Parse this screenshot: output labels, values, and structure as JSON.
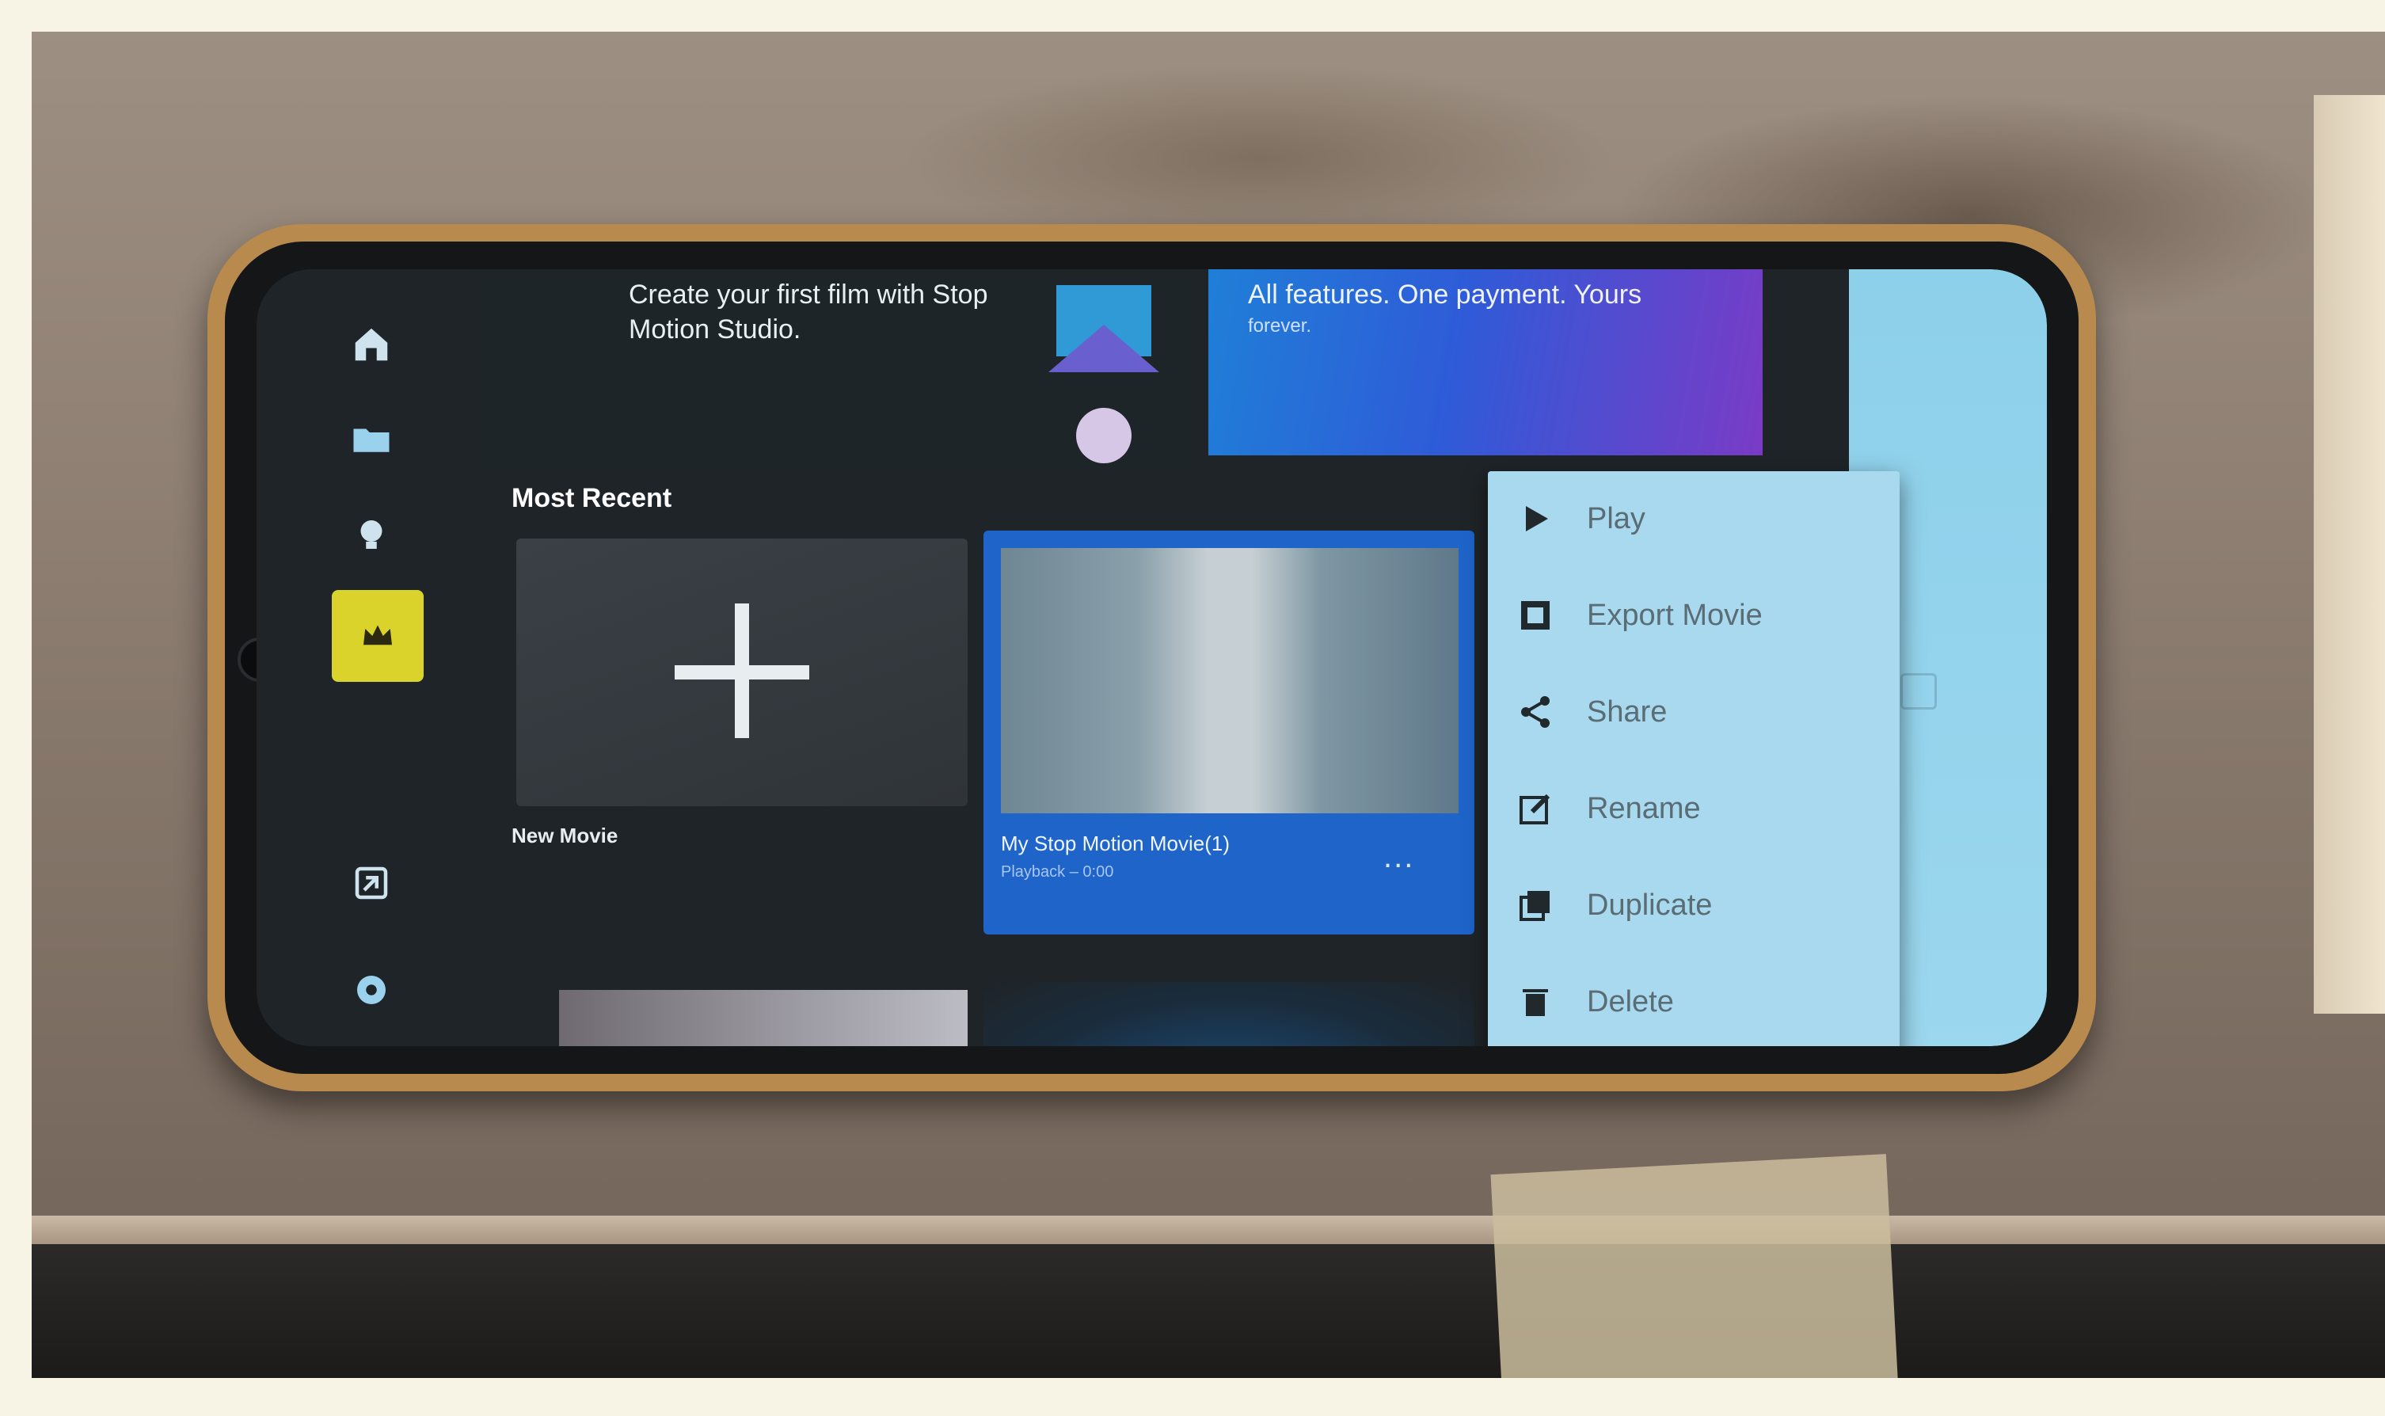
{
  "banner_promo": {
    "text": "Create your first film with Stop Motion Studio."
  },
  "banner_pro": {
    "text": "All features. One payment. Yours",
    "sub": "forever."
  },
  "section": {
    "most_recent": "Most Recent"
  },
  "cards": {
    "new_movie_label": "New Movie",
    "movie_title": "My Stop Motion Movie(1)",
    "movie_meta": "Playback – 0:00",
    "more": "..."
  },
  "context_menu": {
    "items": [
      {
        "label": "Play",
        "icon": "play-icon"
      },
      {
        "label": "Export Movie",
        "icon": "film-icon"
      },
      {
        "label": "Share",
        "icon": "share-icon"
      },
      {
        "label": "Rename",
        "icon": "edit-icon"
      },
      {
        "label": "Duplicate",
        "icon": "duplicate-icon"
      },
      {
        "label": "Delete",
        "icon": "trash-icon"
      }
    ]
  },
  "nav": {
    "items": [
      {
        "name": "home-icon"
      },
      {
        "name": "folder-icon"
      },
      {
        "name": "lightbulb-icon"
      },
      {
        "name": "crown-icon",
        "active": true
      },
      {
        "name": "import-icon"
      },
      {
        "name": "settings-icon"
      }
    ]
  },
  "colors": {
    "accent_yellow": "#d9d32b",
    "selected_card": "#1e64c9",
    "menu_bg": "#a9d9ef",
    "screen_bg": "#1f2428"
  }
}
